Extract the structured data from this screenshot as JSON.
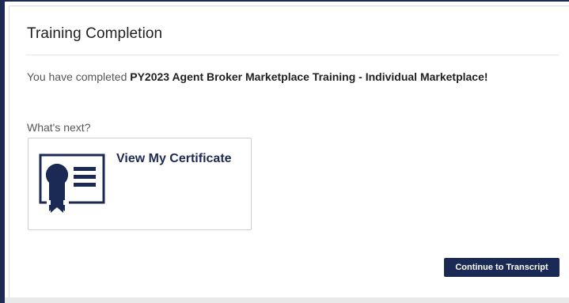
{
  "modal": {
    "title": "Training Completion",
    "message_prefix": "You have completed ",
    "course_name": "PY2023 Agent Broker Marketplace Training - Individual Marketplace!",
    "whats_next_label": "What's next?",
    "certificate_card": {
      "label": "View My Certificate",
      "icon": "certificate-icon"
    },
    "continue_button_label": "Continue to Transcript"
  },
  "colors": {
    "primary": "#1b2a55",
    "text": "#1f1f1f",
    "muted_text": "#555555",
    "border": "#cfcfcf"
  }
}
